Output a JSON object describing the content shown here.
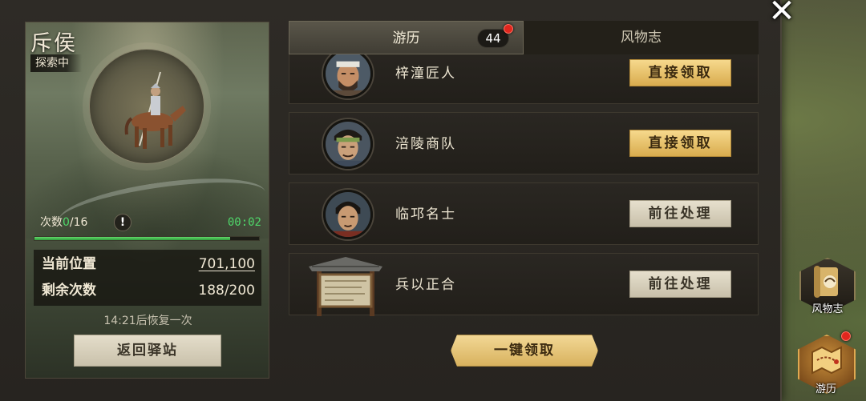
{
  "scout": {
    "title": "斥侯",
    "status": "探索中",
    "count_label": "次数",
    "count_current": "0",
    "count_total": "/16",
    "info_glyph": "!",
    "timer": "00:02",
    "progress": 0.87,
    "position_label": "当前位置",
    "position_value": "701,100",
    "remaining_label": "剩余次数",
    "remaining_value": "188/200",
    "recover_text": "14:21后恢复一次",
    "return_label": "返回驿站"
  },
  "tabs": {
    "travel_label": "游历",
    "travel_count": "44",
    "customs_label": "风物志"
  },
  "events": [
    {
      "name": "梓潼匠人",
      "action": "直接领取",
      "type": "claim",
      "avatar": "man-headband-icon"
    },
    {
      "name": "涪陵商队",
      "action": "直接领取",
      "type": "claim",
      "avatar": "merchant-green-headband-icon"
    },
    {
      "name": "临邛名士",
      "action": "前往处理",
      "type": "goto",
      "avatar": "scholar-icon"
    },
    {
      "name": "兵以正合",
      "action": "前往处理",
      "type": "goto",
      "avatar": "notice-board-icon"
    }
  ],
  "claim_all_label": "一键领取",
  "side_nav": {
    "customs_label": "风物志",
    "travel_label": "游历"
  },
  "colors": {
    "accent_green": "#4fd86a",
    "claim_gold": "#d9ac4e",
    "badge_red": "#e0261e"
  }
}
